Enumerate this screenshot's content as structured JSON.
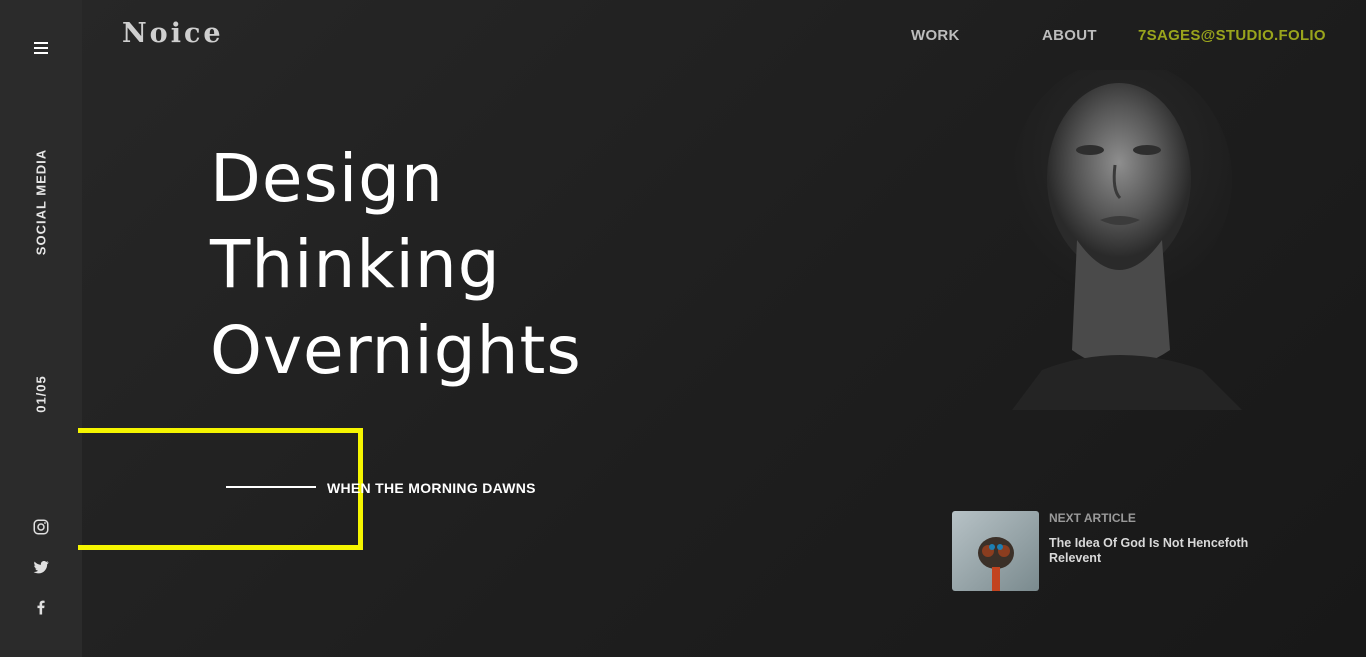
{
  "sidebar": {
    "menu_icon": "hamburger-menu-icon",
    "social_label": "SOCIAL MEDIA",
    "counter": "01/05",
    "social_icons": [
      "instagram-icon",
      "twitter-icon",
      "facebook-icon"
    ]
  },
  "header": {
    "logo": "Noice",
    "nav": {
      "work": "WORK",
      "about": "ABOUT",
      "email": "7SAGES@STUDIO.FOLIO"
    }
  },
  "hero": {
    "title_lines": [
      "Design",
      "Thinking",
      "Overnights"
    ],
    "tagline": "WHEN THE MORNING DAWNS"
  },
  "next_article": {
    "label": "NEXT ARTICLE",
    "title": "The Idea Of God Is Not Hencefoth Relevent"
  },
  "colors": {
    "accent_yellow": "#f5f500",
    "email_accent": "#9aa51c",
    "background": "#1f1f1f",
    "sidebar": "#2b2b2b"
  }
}
